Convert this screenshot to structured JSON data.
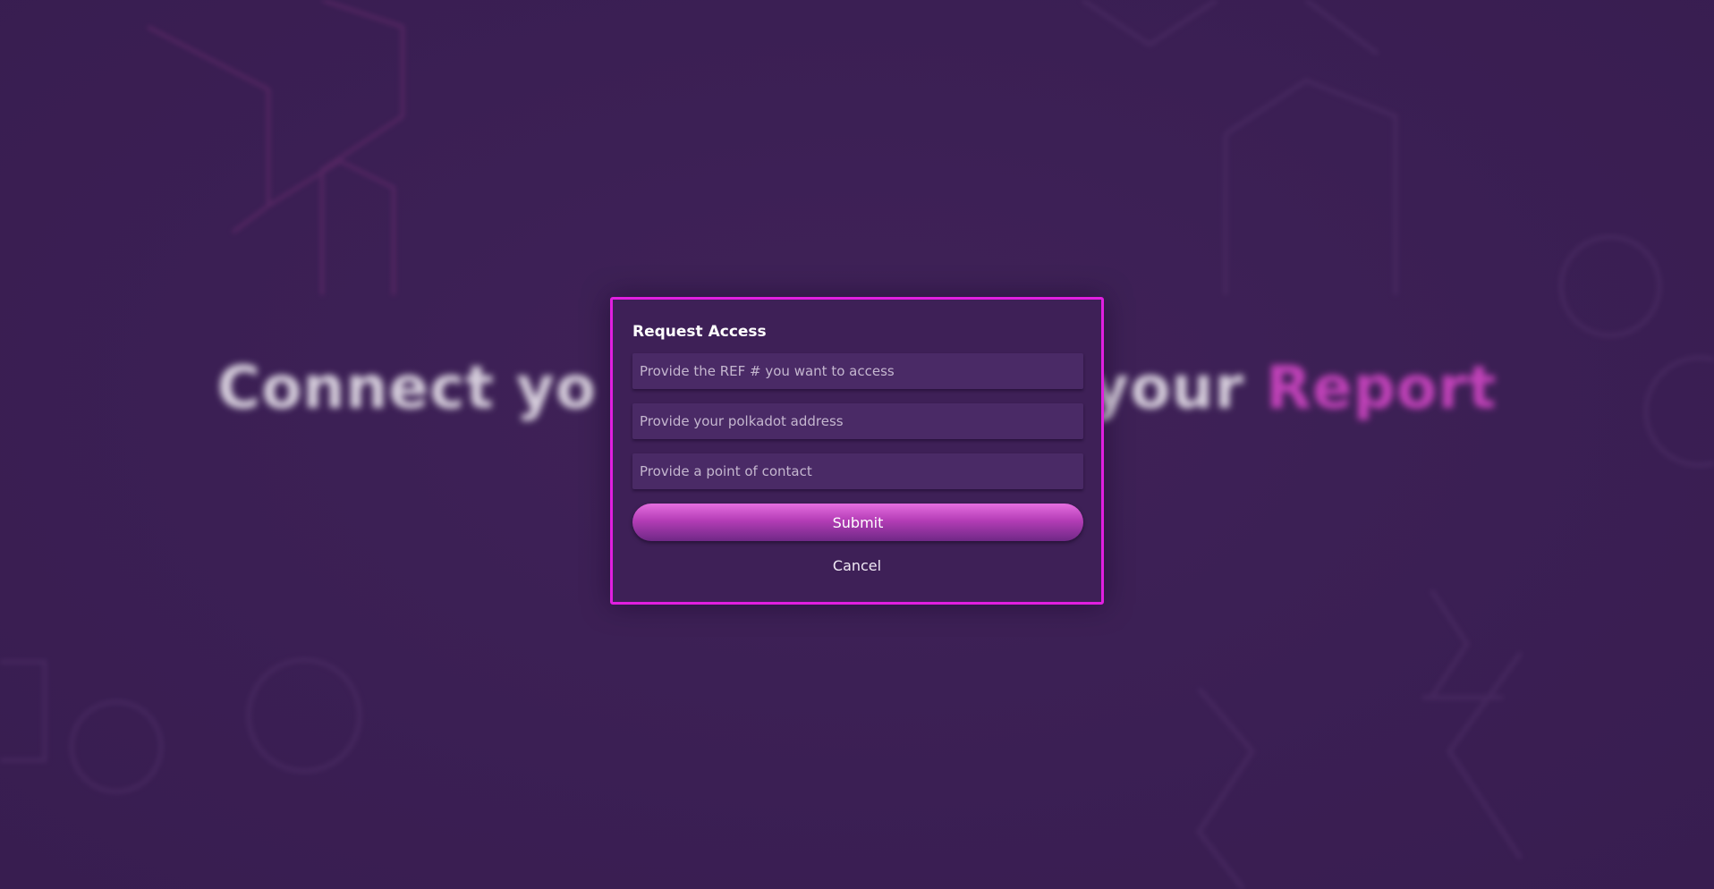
{
  "background": {
    "headline_part1": "Connect yo",
    "headline_part2": "your",
    "headline_accent": "Report"
  },
  "modal": {
    "title": "Request Access",
    "ref_placeholder": "Provide the REF # you want to access",
    "address_placeholder": "Provide your polkadot address",
    "contact_placeholder": "Provide a point of contact",
    "submit_label": "Submit",
    "cancel_label": "Cancel"
  },
  "colors": {
    "background": "#3b1f54",
    "modal_border": "#e11fe0",
    "accent": "#d046c4"
  }
}
